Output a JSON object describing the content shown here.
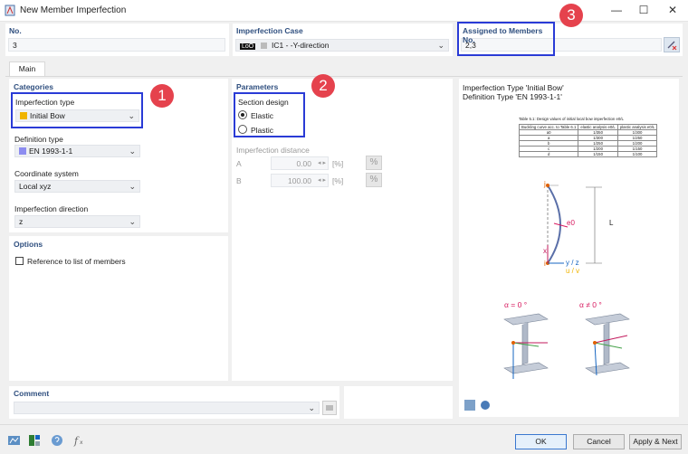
{
  "window": {
    "title": "New Member Imperfection",
    "min": "—",
    "max": "☐",
    "close": "✕"
  },
  "header": {
    "no_label": "No.",
    "no_value": "3",
    "case_label": "Imperfection Case",
    "case_tag": "LoO",
    "case_value": "IC1 - -Y-direction",
    "assigned_label": "Assigned to Members No.",
    "assigned_value": "2,3"
  },
  "tabs": [
    "Main"
  ],
  "categories": {
    "title": "Categories",
    "imperfection_type_label": "Imperfection type",
    "imperfection_type_value": "Initial Bow",
    "imperfection_type_color": "#f0b400",
    "definition_type_label": "Definition type",
    "definition_type_value": "EN 1993-1-1",
    "definition_type_color": "#8c8cf0",
    "coordinate_system_label": "Coordinate system",
    "coordinate_system_value": "Local xyz",
    "imperfection_direction_label": "Imperfection direction",
    "imperfection_direction_value": "z"
  },
  "options": {
    "title": "Options",
    "reference_label": "Reference to list of members"
  },
  "parameters": {
    "title": "Parameters",
    "section_design_label": "Section design",
    "elastic_label": "Elastic",
    "plastic_label": "Plastic",
    "distance_label": "Imperfection distance",
    "a_label": "A",
    "a_value": "0.00",
    "b_label": "B",
    "b_value": "100.00",
    "unit": "[%]",
    "pct_btn": "%"
  },
  "info": {
    "line1": "Imperfection Type 'Initial Bow'",
    "line2": "Definition Type 'EN 1993-1-1'",
    "table_caption": "Table 5.1: Design values of initial local bow imperfection e0/L",
    "table_headers": [
      "Buckling curve acc. to Table 6.1",
      "elastic analysis e0/L",
      "plastic analysis e0/L"
    ],
    "table_rows": [
      [
        "a0",
        "1/350",
        "1/300"
      ],
      [
        "a",
        "1/300",
        "1/250"
      ],
      [
        "b",
        "1/250",
        "1/200"
      ],
      [
        "c",
        "1/200",
        "1/150"
      ],
      [
        "d",
        "1/150",
        "1/100"
      ]
    ],
    "diag_j": "j",
    "diag_i": "i",
    "diag_e0": "e0",
    "diag_L": "L",
    "diag_x": "x",
    "diag_yz": "y / z",
    "diag_uv": "u / v",
    "alpha0": "α = 0 °",
    "alpha_ne0": "α ≠ 0 °"
  },
  "comment": {
    "label": "Comment"
  },
  "buttons": {
    "ok": "OK",
    "cancel": "Cancel",
    "apply_next": "Apply & Next"
  },
  "badges": [
    "1",
    "2",
    "3"
  ]
}
